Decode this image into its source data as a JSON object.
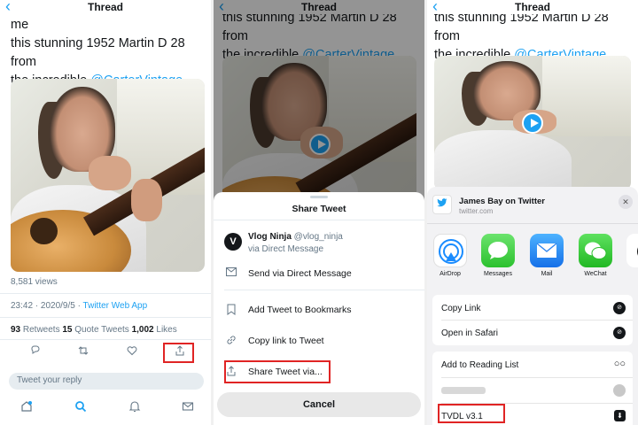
{
  "panel1": {
    "title": "Thread",
    "back": "‹",
    "tweet_line1": "luckiest lad in the world - Lucy got me",
    "tweet_line2": "this stunning 1952 Martin D 28 from",
    "tweet_line3": "the incredible ",
    "mention": "@CarterVintage",
    "views": "8,581 views",
    "time": "23:42 · 2020/9/5 · ",
    "source": "Twitter Web App",
    "retweets_n": "93",
    "retweets_l": " Retweets ",
    "quotes_n": "15",
    "quotes_l": " Quote Tweets ",
    "likes_n": "1,002",
    "likes_l": " Likes",
    "reply_placeholder": "Tweet your reply"
  },
  "panel2": {
    "title": "Thread",
    "back": "‹",
    "tweet_line1": "this stunning 1952 Martin D 28 from",
    "tweet_line2": "the incredible ",
    "mention": "@CarterVintage",
    "sheet_title": "Share Tweet",
    "dm_user": "Vlog Ninja",
    "dm_handle": " @vlog_ninja",
    "dm_via": "via Direct Message",
    "dm_avatar": "V",
    "items": [
      "Send via Direct Message",
      "Add Tweet to Bookmarks",
      "Copy link to Tweet",
      "Share Tweet via..."
    ],
    "cancel": "Cancel"
  },
  "panel3": {
    "title": "Thread",
    "back": "‹",
    "tweet_line1": "this stunning 1952 Martin D 28 from",
    "tweet_line2": "the incredible ",
    "mention": "@CarterVintage",
    "share_title": "James Bay on Twitter",
    "share_url": "twitter.com",
    "apps": [
      "AirDrop",
      "Messages",
      "Mail",
      "WeChat"
    ],
    "actions1": [
      "Copy Link",
      "Open in Safari"
    ],
    "actions2": [
      "Add to Reading List",
      "",
      "TVDL v3.1"
    ]
  },
  "colors": {
    "accent": "#1da1f2",
    "highlight": "#e02424"
  }
}
